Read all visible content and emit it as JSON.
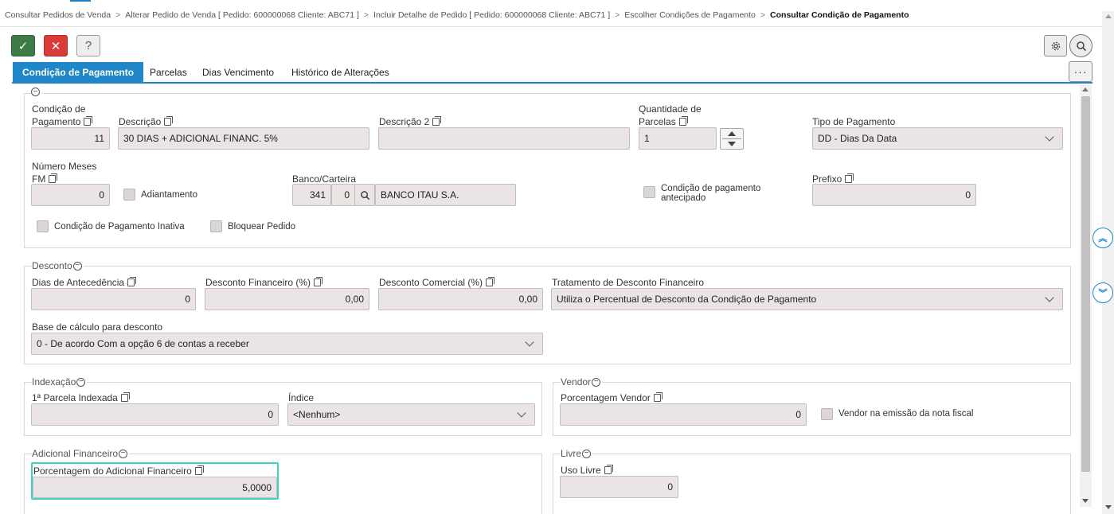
{
  "breadcrumb": {
    "items": [
      "Consultar Pedidos de Venda",
      "Alterar Pedido de Venda [ Pedido: 600000068 Cliente: ABC71 ]",
      "Incluir Detalhe de Pedido [ Pedido: 600000068 Cliente: ABC71 ]",
      "Escolher Condições de Pagamento"
    ],
    "separator": ">",
    "current": "Consultar Condição de Pagamento"
  },
  "toolbar": {
    "confirm_icon": "✓",
    "cancel_icon": "✕",
    "help_label": "?",
    "more_label": "···"
  },
  "tabs": [
    {
      "label": "Condição de Pagamento",
      "active": true
    },
    {
      "label": "Parcelas",
      "active": false
    },
    {
      "label": "Dias Vencimento",
      "active": false
    },
    {
      "label": "Histórico de Alterações",
      "active": false
    }
  ],
  "section_main": {
    "condicao_label_1": "Condição de",
    "condicao_label_2": "Pagamento",
    "condicao_value": "11",
    "descricao_label": "Descrição",
    "descricao_value": "30 DIAS + ADICIONAL FINANC. 5%",
    "descricao2_label": "Descrição 2",
    "descricao2_value": "",
    "qtd_parcelas_label_1": "Quantidade de",
    "qtd_parcelas_label_2": "Parcelas",
    "qtd_parcelas_value": "1",
    "tipo_pagamento_label": "Tipo de Pagamento",
    "tipo_pagamento_value": "DD - Dias Da Data",
    "num_meses_label_1": "Número Meses",
    "num_meses_label_2": "FM",
    "num_meses_value": "0",
    "adiantamento_label": "Adiantamento",
    "banco_label": "Banco/Carteira",
    "banco_code": "341",
    "carteira_code": "0",
    "banco_name": "BANCO ITAU S.A.",
    "cond_antecipado_label_1": "Condição de pagamento",
    "cond_antecipado_label_2": "antecipado",
    "prefixo_label": "Prefixo",
    "prefixo_value": "0",
    "inativa_label": "Condição de Pagamento Inativa",
    "bloquear_label": "Bloquear Pedido"
  },
  "section_desconto": {
    "title": "Desconto",
    "dias_antecedencia_label": "Dias de Antecedência",
    "dias_antecedencia_value": "0",
    "desc_financeiro_label": "Desconto Financeiro (%)",
    "desc_financeiro_value": "0,00",
    "desc_comercial_label": "Desconto Comercial (%)",
    "desc_comercial_value": "0,00",
    "tratamento_label": "Tratamento de Desconto Financeiro",
    "tratamento_value": "Utiliza o Percentual de Desconto da Condição de Pagamento",
    "base_calculo_label": "Base de cálculo para desconto",
    "base_calculo_value": "0 - De acordo Com a opção 6 de contas a receber"
  },
  "section_indexacao": {
    "title": "Indexação",
    "parcela_indexada_label": "1ª Parcela Indexada",
    "parcela_indexada_value": "0",
    "indice_label": "Índice",
    "indice_value": "<Nenhum>"
  },
  "section_vendor": {
    "title": "Vendor",
    "porcentagem_label": "Porcentagem Vendor",
    "porcentagem_value": "0",
    "emissao_label": "Vendor na emissão da nota fiscal"
  },
  "section_adicional": {
    "title": "Adicional Financeiro",
    "porcentagem_label": "Porcentagem do Adicional Financeiro",
    "porcentagem_value": "5,0000"
  },
  "section_livre": {
    "title": "Livre",
    "uso_livre_label": "Uso Livre",
    "uso_livre_value": "0"
  },
  "side_nav": {
    "up_label": "︽",
    "down_label": "︾"
  },
  "colors": {
    "accent": "#1f87c7",
    "confirm": "#3d7a45",
    "cancel": "#d93a3a",
    "field_bg": "#ebe4e4",
    "focus": "#3fd3bf"
  }
}
